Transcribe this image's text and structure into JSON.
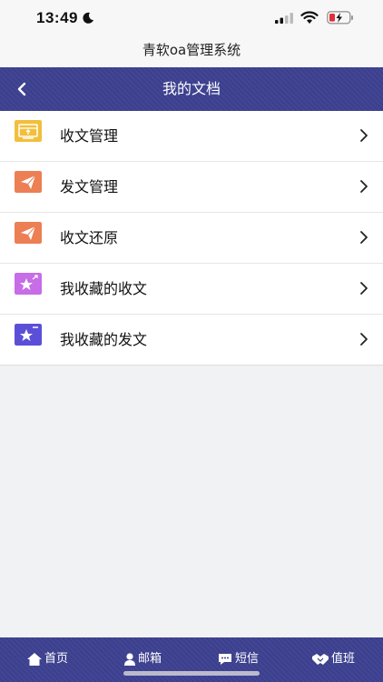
{
  "status_bar": {
    "time": "13:49"
  },
  "app": {
    "title": "青软oa管理系统"
  },
  "nav": {
    "title": "我的文档"
  },
  "menu": {
    "items": [
      {
        "label": "收文管理",
        "icon": "inbox-tray-icon",
        "color": "#f2bf3c"
      },
      {
        "label": "发文管理",
        "icon": "paper-plane-icon",
        "color": "#ec7f54"
      },
      {
        "label": "收文还原",
        "icon": "paper-plane-icon",
        "color": "#ec7f54"
      },
      {
        "label": "我收藏的收文",
        "icon": "star-icon",
        "color": "#c66de7"
      },
      {
        "label": "我收藏的发文",
        "icon": "star-icon",
        "color": "#5b4fd8"
      }
    ]
  },
  "tab_bar": {
    "tabs": [
      {
        "label": "首页",
        "icon": "home-icon"
      },
      {
        "label": "邮箱",
        "icon": "user-icon"
      },
      {
        "label": "短信",
        "icon": "chat-icon"
      },
      {
        "label": "值班",
        "icon": "handshake-icon"
      }
    ]
  },
  "colors": {
    "primary": "#3b3f8e",
    "background": "#f1f2f4"
  }
}
